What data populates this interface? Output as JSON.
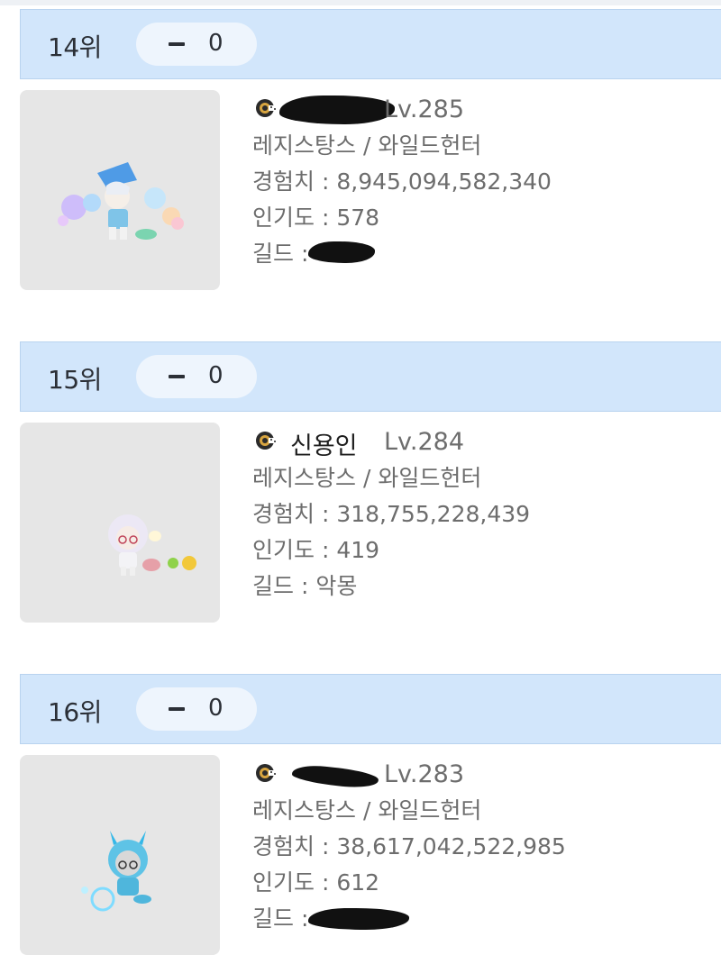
{
  "rankings": [
    {
      "rank_label": "14위",
      "change_value": "0",
      "name": "",
      "level": "Lv.285",
      "job": "레지스탕스 / 와일드헌터",
      "exp_label": "경험치",
      "exp": "8,945,094,582,340",
      "fame_label": "인기도",
      "fame": "578",
      "guild_label": "길드",
      "guild": "",
      "name_redacted": true,
      "guild_redacted": true
    },
    {
      "rank_label": "15위",
      "change_value": "0",
      "name": "신용인",
      "level": "Lv.284",
      "job": "레지스탕스 / 와일드헌터",
      "exp_label": "경험치",
      "exp": "318,755,228,439",
      "fame_label": "인기도",
      "fame": "419",
      "guild_label": "길드",
      "guild": "악몽",
      "name_redacted": false,
      "guild_redacted": false
    },
    {
      "rank_label": "16위",
      "change_value": "0",
      "name": "",
      "level": "Lv.283",
      "job": "레지스탕스 / 와일드헌터",
      "exp_label": "경험치",
      "exp": "38,617,042,522,985",
      "fame_label": "인기도",
      "fame": "612",
      "guild_label": "길드",
      "guild": "",
      "name_redacted": true,
      "guild_redacted": true
    }
  ],
  "separator": " : ",
  "colors": {
    "header_bg": "#d2e6fb",
    "pill_bg": "#eef5fd",
    "avatar_bg": "#e6e6e6",
    "muted_text": "#6d6d6d"
  },
  "icons": {
    "rank_change": "dash-icon",
    "guild_emblem": "guild-emblem-icon"
  }
}
